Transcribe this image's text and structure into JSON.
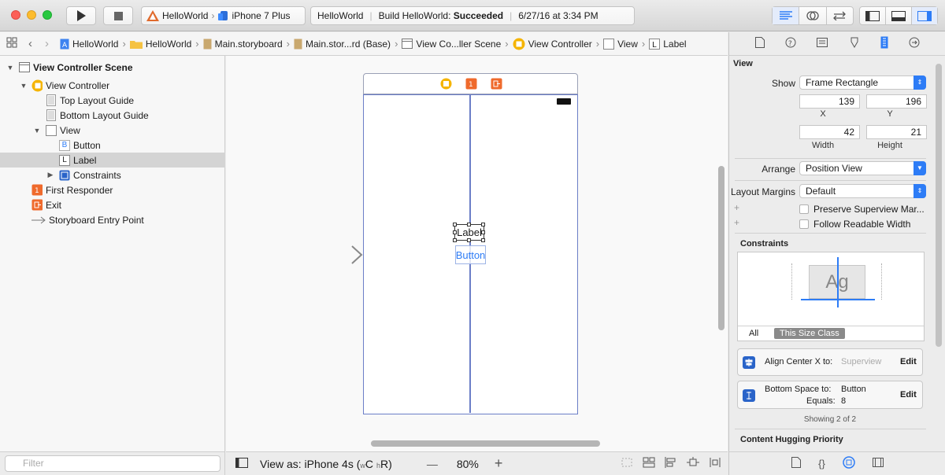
{
  "toolbar": {
    "scheme_project": "HelloWorld",
    "scheme_device": "iPhone 7 Plus",
    "activity_project": "HelloWorld",
    "activity_status_prefix": "Build HelloWorld: ",
    "activity_status_bold": "Succeeded",
    "activity_time": "6/27/16 at 3:34 PM"
  },
  "jumpbar": {
    "crumbs": [
      "HelloWorld",
      "HelloWorld",
      "Main.storyboard",
      "Main.stor...rd (Base)",
      "View Co...ller Scene",
      "View Controller",
      "View",
      "Label"
    ]
  },
  "navigator": {
    "items": [
      {
        "label": "View Controller Scene"
      },
      {
        "label": "View Controller"
      },
      {
        "label": "Top Layout Guide"
      },
      {
        "label": "Bottom Layout Guide"
      },
      {
        "label": "View"
      },
      {
        "label": "Button",
        "badge": "B"
      },
      {
        "label": "Label",
        "badge": "L"
      },
      {
        "label": "Constraints"
      },
      {
        "label": "First Responder"
      },
      {
        "label": "Exit"
      },
      {
        "label": "Storyboard Entry Point"
      }
    ],
    "filter_placeholder": "Filter"
  },
  "canvas": {
    "label_text": "Label",
    "button_text": "Button",
    "view_as_prefix": "View as: iPhone 4s (",
    "view_as_w": "w",
    "view_as_c": "C",
    "view_as_h": "h",
    "view_as_r": "R",
    "view_as_suffix": ")",
    "zoom_minus": "—",
    "zoom_level": "80%",
    "zoom_plus": "+"
  },
  "inspector": {
    "section_title": "View",
    "show_label": "Show",
    "show_value": "Frame Rectangle",
    "x_value": "139",
    "y_value": "196",
    "x_caption": "X",
    "y_caption": "Y",
    "width_value": "42",
    "height_value": "21",
    "width_caption": "Width",
    "height_caption": "Height",
    "arrange_label": "Arrange",
    "arrange_value": "Position View",
    "layout_margins_label": "Layout Margins",
    "layout_margins_value": "Default",
    "plus_1": "+",
    "plus_2": "+",
    "preserve_superview": "Preserve Superview Mar...",
    "follow_readable": "Follow Readable Width",
    "constraints_title": "Constraints",
    "constraints_preview_text": "Ag",
    "tab_all": "All",
    "tab_this_size": "This Size Class",
    "constraint1_label": "Align Center X to:",
    "constraint1_target": "Superview",
    "constraint1_edit": "Edit",
    "constraint2_line1": "Bottom Space to:",
    "constraint2_target": "Button",
    "constraint2_equals": "Equals:",
    "constraint2_value": "8",
    "constraint2_edit": "Edit",
    "showing": "Showing 2 of 2",
    "content_hugging": "Content Hugging Priority"
  },
  "colors": {
    "accent": "#2d7cf6",
    "canvas_guide": "#6b7ec7",
    "label_selection": "#333333",
    "button_text": "#2d7cf6"
  }
}
